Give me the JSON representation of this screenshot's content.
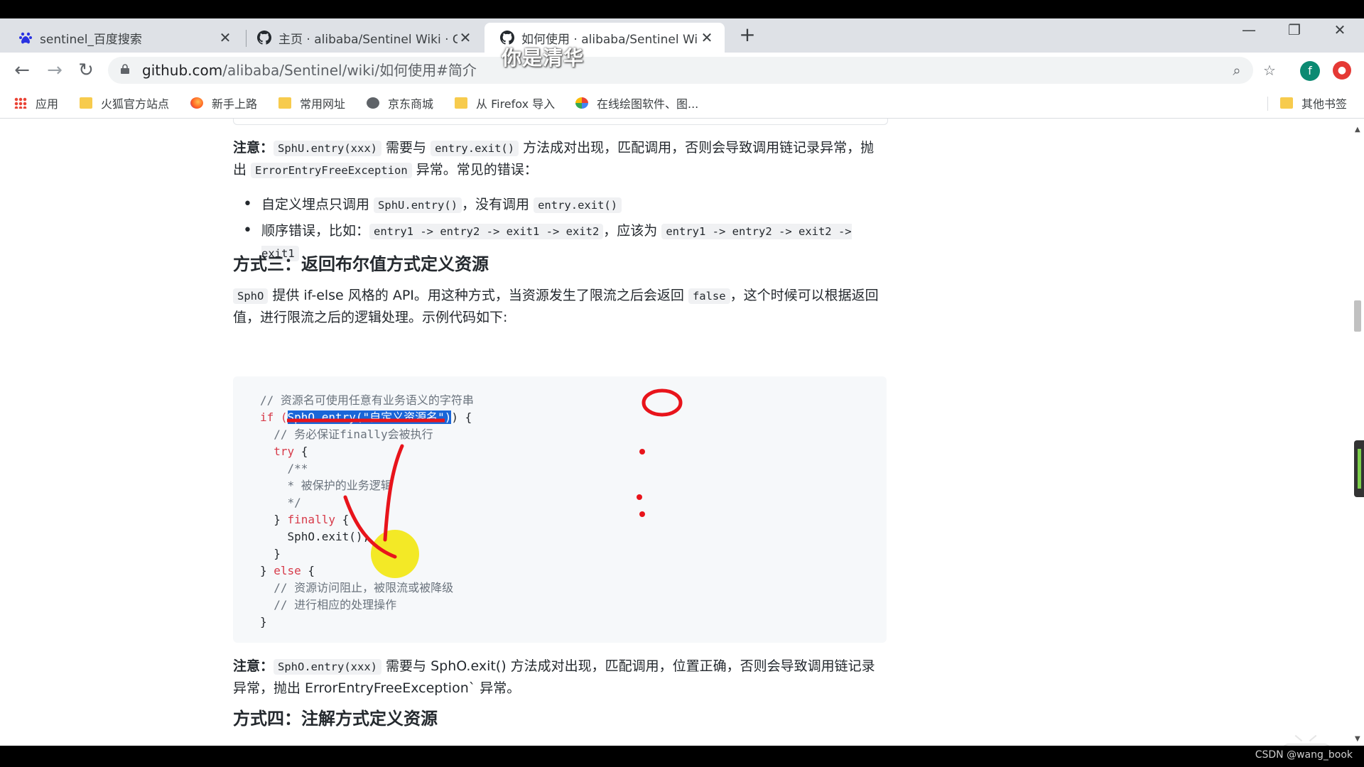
{
  "browser": {
    "tabs": [
      {
        "title": "sentinel_百度搜索",
        "icon": "baidu-icon"
      },
      {
        "title": "主页 · alibaba/Sentinel Wiki · G",
        "icon": "github-icon"
      },
      {
        "title": "如何使用 · alibaba/Sentinel Wi",
        "icon": "github-icon",
        "active": true
      }
    ],
    "new_tab_label": "+",
    "url_host": "github.com",
    "url_path": "/alibaba/Sentinel/wiki/如何使用#简介",
    "profile_initial": "f",
    "bookmarks": [
      {
        "label": "应用",
        "icon": "apps-grid-icon"
      },
      {
        "label": "火狐官方站点",
        "icon": "folder-icon"
      },
      {
        "label": "新手上路",
        "icon": "firefox-icon"
      },
      {
        "label": "常用网址",
        "icon": "folder-icon"
      },
      {
        "label": "京东商城",
        "icon": "globe-icon"
      },
      {
        "label": "从 Firefox 导入",
        "icon": "folder-icon"
      },
      {
        "label": "在线绘图软件、图...",
        "icon": "drawing-icon"
      },
      {
        "label": "其他书签",
        "icon": "folder-icon"
      }
    ]
  },
  "overlay_text": "你是清华",
  "watermark": "CSDN @wang_book",
  "article": {
    "note1": {
      "label": "注意：",
      "code1": "SphU.entry(xxx)",
      "t1": " 需要与 ",
      "code2": "entry.exit()",
      "t2": " 方法成对出现，匹配调用，否则会导致调用链记录异常，抛出 ",
      "code3": "ErrorEntryFreeException",
      "t3": " 异常。常见的错误："
    },
    "errors": [
      {
        "t1": "自定义埋点只调用 ",
        "c1": "SphU.entry()",
        "t2": "，没有调用 ",
        "c2": "entry.exit()"
      },
      {
        "t1": "顺序错误，比如：",
        "c1": "entry1 -> entry2 -> exit1 -> exit2",
        "t2": "，应该为 ",
        "c2": "entry1 -> entry2 -> exit2 -> exit1"
      }
    ],
    "h3_method3": "方式三：返回布尔值方式定义资源",
    "para3": {
      "code": "SphO",
      "t1": " 提供 if-else 风格的 API。用这种方式，当资源发生了限流之后会返回 ",
      "code2": "false",
      "t2": "，这个时候可以根据返回值，进行限流之后的逻辑处理。示例代码如下:"
    },
    "code_lines": {
      "l1": "// 资源名可使用任意有业务语义的字符串",
      "l2a": "if (",
      "l2b": "SphO.entry(\"自定义资源名\")",
      "l2c": ") {",
      "l3": "  // 务必保证finally会被执行",
      "l4a": "  ",
      "l4b": "try",
      "l4c": " {",
      "l5": "    /**",
      "l6": "    * 被保护的业务逻辑",
      "l7": "    */",
      "l8a": "  } ",
      "l8b": "finally",
      "l8c": " {",
      "l9": "    SphO.exit();",
      "l10": "  }",
      "l11a": "} ",
      "l11b": "else",
      "l11c": " {",
      "l12": "  // 资源访问阻止，被限流或被降级",
      "l13": "  // 进行相应的处理操作",
      "l14": "}"
    },
    "note2": {
      "label": "注意：",
      "code": "SphO.entry(xxx)",
      "t1": " 需要与 SphO.exit() 方法成对出现，匹配调用，位置正确，否则会导致调用链记录异常，抛出 ErrorEntryFreeException` 异常。"
    },
    "h3_method4": "方式四：注解方式定义资源"
  },
  "colors": {
    "highlight": "#1a66d8",
    "annotation_red": "#e8141b",
    "cursor_yellow": "#f2e600"
  }
}
